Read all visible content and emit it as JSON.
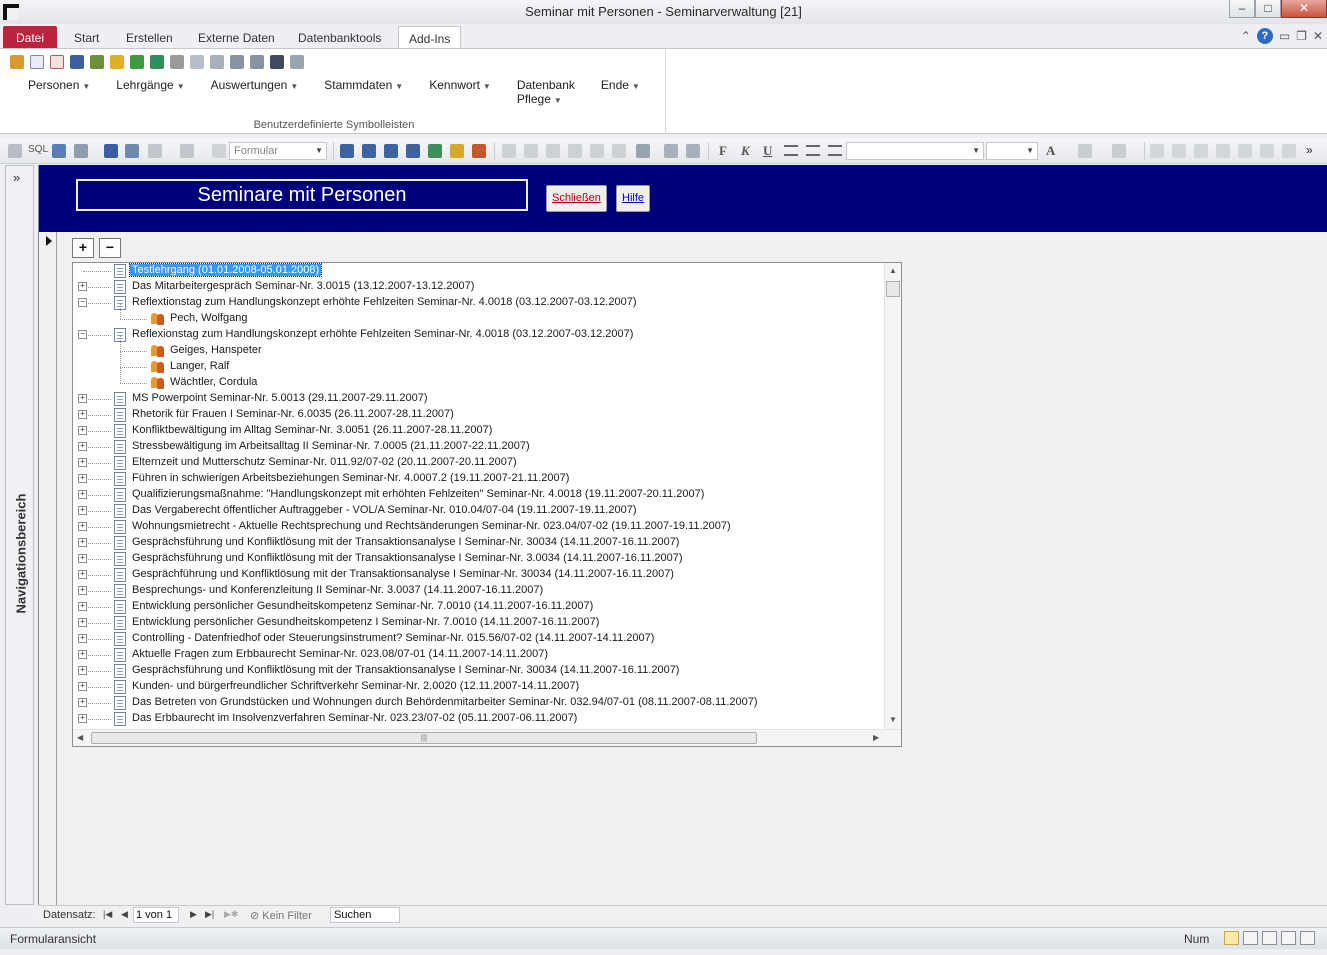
{
  "window": {
    "title": "Seminar mit Personen  -  Seminarverwaltung [21]"
  },
  "ribbon": {
    "tabs": [
      "Datei",
      "Start",
      "Erstellen",
      "Externe Daten",
      "Datenbanktools",
      "Add-Ins"
    ],
    "active_tab": "Add-Ins",
    "menus": [
      "Personen",
      "Lehrgänge",
      "Auswertungen",
      "Stammdaten",
      "Kennwort",
      "Datenbank Pflege",
      "Ende"
    ],
    "group_label": "Benutzerdefinierte Symbolleisten"
  },
  "toolbar": {
    "sql_label": "SQL",
    "object_combo": "Formular",
    "bold": "F",
    "italic": "K",
    "underline": "U",
    "font_color": "A"
  },
  "navpane": {
    "label": "Navigationsbereich",
    "toggle": "»"
  },
  "form": {
    "title": "Seminare mit Personen",
    "close_label": "Schließen",
    "help_label": "Hilfe",
    "expand_all": "+",
    "collapse_all": "−"
  },
  "tree": {
    "nodes": [
      {
        "text": "Testlehrgang (01.01.2008-05.01.2008)",
        "expander": "",
        "selected": true
      },
      {
        "text": "Das Mitarbeitergespräch Seminar-Nr. 3.0015 (13.12.2007-13.12.2007)",
        "expander": "+"
      },
      {
        "text": "Reflextionstag zum Handlungskonzept erhöhte Fehlzeiten Seminar-Nr. 4.0018 (03.12.2007-03.12.2007)",
        "expander": "−",
        "children": [
          "Pech, Wolfgang"
        ]
      },
      {
        "text": "Reflexionstag zum Handlungskonzept erhöhte Fehlzeiten Seminar-Nr. 4.0018 (03.12.2007-03.12.2007)",
        "expander": "−",
        "children": [
          "Geiges, Hanspeter",
          "Langer, Ralf",
          "Wächtler, Cordula"
        ]
      },
      {
        "text": "MS Powerpoint Seminar-Nr. 5.0013 (29.11.2007-29.11.2007)",
        "expander": "+"
      },
      {
        "text": "Rhetorik für Frauen I Seminar-Nr. 6.0035 (26.11.2007-28.11.2007)",
        "expander": "+"
      },
      {
        "text": "Konfliktbewältigung im Alltag Seminar-Nr. 3.0051 (26.11.2007-28.11.2007)",
        "expander": "+"
      },
      {
        "text": "Stressbewältigung im Arbeitsalltag II Seminar-Nr. 7.0005 (21.11.2007-22.11.2007)",
        "expander": "+"
      },
      {
        "text": "Elternzeit und Mutterschutz Seminar-Nr. 011.92/07-02 (20.11.2007-20.11.2007)",
        "expander": "+"
      },
      {
        "text": "Führen in schwierigen Arbeitsbeziehungen Seminar-Nr. 4.0007.2 (19.11.2007-21.11.2007)",
        "expander": "+"
      },
      {
        "text": "Qualifizierungsmaßnahme: \"Handlungskonzept mit erhöhten Fehlzeiten\" Seminar-Nr. 4.0018 (19.11.2007-20.11.2007)",
        "expander": "+"
      },
      {
        "text": "Das Vergaberecht öffentlicher Auftraggeber - VOL/A Seminar-Nr. 010.04/07-04 (19.11.2007-19.11.2007)",
        "expander": "+"
      },
      {
        "text": "Wohnungsmietrecht - Aktuelle Rechtsprechung und Rechtsänderungen Seminar-Nr. 023.04/07-02 (19.11.2007-19.11.2007)",
        "expander": "+"
      },
      {
        "text": "Gesprächsführung und Konfliktlösung mit der Transaktionsanalyse I Seminar-Nr. 30034 (14.11.2007-16.11.2007)",
        "expander": "+"
      },
      {
        "text": "Gesprächsführung und Konfliktlösung mit der Transaktionsanalyse I Seminar-Nr. 3.0034 (14.11.2007-16.11.2007)",
        "expander": "+"
      },
      {
        "text": "Gesprächführung und Konfliktlösung mit der Transaktionsanalyse I Seminar-Nr. 30034 (14.11.2007-16.11.2007)",
        "expander": "+"
      },
      {
        "text": "Besprechungs- und Konferenzleitung II Seminar-Nr. 3.0037 (14.11.2007-16.11.2007)",
        "expander": "+"
      },
      {
        "text": "Entwicklung persönlicher Gesundheitskompetenz Seminar-Nr. 7.0010 (14.11.2007-16.11.2007)",
        "expander": "+"
      },
      {
        "text": "Entwicklung persönlicher Gesundheitskompetenz I Seminar-Nr. 7.0010 (14.11.2007-16.11.2007)",
        "expander": "+"
      },
      {
        "text": "Controlling - Datenfriedhof oder Steuerungsinstrument? Seminar-Nr. 015.56/07-02 (14.11.2007-14.11.2007)",
        "expander": "+"
      },
      {
        "text": "Aktuelle Fragen zum Erbbaurecht Seminar-Nr. 023.08/07-01 (14.11.2007-14.11.2007)",
        "expander": "+"
      },
      {
        "text": "Gesprächsführung und  Konfliktlösung mit der Transaktionsanalyse I Seminar-Nr. 30034 (14.11.2007-16.11.2007)",
        "expander": "+"
      },
      {
        "text": "Kunden- und bürgerfreundlicher Schriftverkehr Seminar-Nr. 2.0020 (12.11.2007-14.11.2007)",
        "expander": "+"
      },
      {
        "text": "Das Betreten von Grundstücken und Wohnungen durch Behördenmitarbeiter Seminar-Nr. 032.94/07-01 (08.11.2007-08.11.2007)",
        "expander": "+"
      },
      {
        "text": "Das Erbbaurecht im Insolvenzverfahren Seminar-Nr. 023.23/07-02 (05.11.2007-06.11.2007)",
        "expander": "+"
      }
    ]
  },
  "recordnav": {
    "label": "Datensatz:",
    "position": "1 von 1",
    "filter": "Kein Filter",
    "search": "Suchen"
  },
  "statusbar": {
    "left": "Formularansicht",
    "num": "Num"
  },
  "colors": {
    "header_bg": "#00007a",
    "file_tab": "#c0213e",
    "selection": "#3399ff"
  }
}
